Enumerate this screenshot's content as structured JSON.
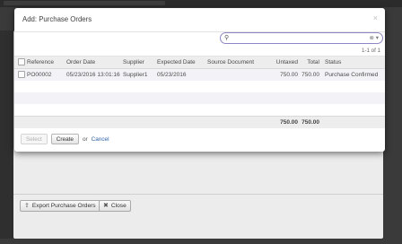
{
  "dialog": {
    "title": "Add: Purchase Orders",
    "close_glyph": "×",
    "search": {
      "placeholder": "",
      "value": ""
    },
    "pager": "1-1 of 1",
    "columns": [
      "Reference",
      "Order Date",
      "Supplier",
      "Expected Date",
      "Source Document",
      "Untaxed",
      "Total",
      "Status"
    ],
    "rows": [
      {
        "reference": "PO00002",
        "order_date": "05/23/2016 13:01:16",
        "supplier": "Supplier1",
        "expected_date": "05/23/2016",
        "source_document": "",
        "untaxed": "750.00",
        "total": "750.00",
        "status": "Purchase Confirmed"
      }
    ],
    "totals": {
      "untaxed": "750.00",
      "total": "750.00"
    },
    "buttons": {
      "select": "Select",
      "create": "Create",
      "or": "or",
      "cancel": "Cancel"
    }
  },
  "background": {
    "buttons": {
      "export": "Export Purchase Orders",
      "close": "Close"
    }
  },
  "icons": {
    "search": "search-icon",
    "dropdown": "dropdown-icon",
    "export": "export-icon",
    "close": "x-icon"
  },
  "colors": {
    "link": "#2e62a8",
    "search_border": "#8c86c6"
  }
}
